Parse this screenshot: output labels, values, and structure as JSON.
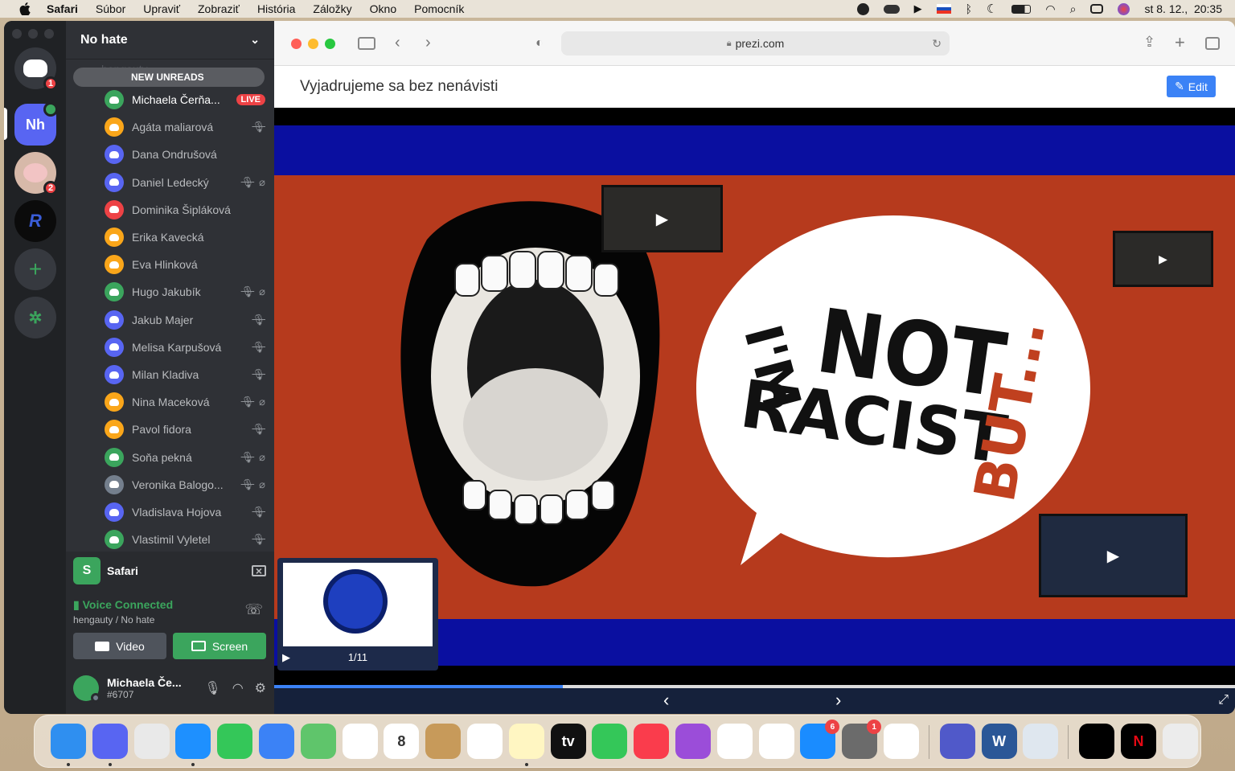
{
  "menubar": {
    "app": "Safari",
    "items": [
      "Súbor",
      "Upraviť",
      "Zobraziť",
      "História",
      "Záložky",
      "Okno",
      "Pomocník"
    ],
    "datetime": "st 8. 12.,  20:35"
  },
  "discord": {
    "servers": [
      {
        "name": "Discord home",
        "label": "",
        "badge": "1",
        "color": "#36393f"
      },
      {
        "name": "No hate server",
        "label": "Nh",
        "badge": "",
        "color": "#5865f2"
      },
      {
        "name": "pig server",
        "label": "",
        "badge": "2",
        "color": "#d7b9a9"
      },
      {
        "name": "RaveX003 server",
        "label": "R",
        "badge": "",
        "color": "#0b0b0b"
      }
    ],
    "channel_header": "No hate",
    "ghost_channel": "hengauty",
    "new_unreads": "NEW UNREADS",
    "members": [
      {
        "name": "Michaela Čerňa...",
        "color": "#3ba55d",
        "live": "LIVE",
        "deaf": false,
        "muted": false
      },
      {
        "name": "Agáta maliarová",
        "color": "#faa61a",
        "muted": true,
        "deaf": false
      },
      {
        "name": "Dana Ondrušová",
        "color": "#5865f2",
        "muted": false,
        "deaf": false
      },
      {
        "name": "Daniel Ledecký",
        "color": "#5865f2",
        "muted": true,
        "deaf": true
      },
      {
        "name": "Dominika Šipláková",
        "color": "#ed4245",
        "muted": false,
        "deaf": false
      },
      {
        "name": "Erika Kavecká",
        "color": "#faa61a",
        "muted": false,
        "deaf": false
      },
      {
        "name": "Eva Hlinková",
        "color": "#faa61a",
        "muted": false,
        "deaf": false
      },
      {
        "name": "Hugo Jakubík",
        "color": "#3ba55d",
        "muted": true,
        "deaf": true
      },
      {
        "name": "Jakub Majer",
        "color": "#5865f2",
        "muted": true,
        "deaf": false
      },
      {
        "name": "Melisa Karpušová",
        "color": "#5865f2",
        "muted": true,
        "deaf": false
      },
      {
        "name": "Milan Kladiva",
        "color": "#5865f2",
        "muted": true,
        "deaf": false
      },
      {
        "name": "Nina Maceková",
        "color": "#faa61a",
        "muted": true,
        "deaf": true
      },
      {
        "name": "Pavol fidora",
        "color": "#faa61a",
        "muted": true,
        "deaf": false
      },
      {
        "name": "Soňa pekná",
        "color": "#3ba55d",
        "muted": true,
        "deaf": true
      },
      {
        "name": "Veronika Balogo...",
        "color": "#747f8d",
        "muted": true,
        "deaf": true
      },
      {
        "name": "Vladislava Hojova",
        "color": "#5865f2",
        "muted": true,
        "deaf": false
      },
      {
        "name": "Vlastimil Vyletel",
        "color": "#3ba55d",
        "muted": true,
        "deaf": false
      }
    ],
    "share": {
      "app": "Safari"
    },
    "voice": {
      "status": "Voice Connected",
      "location": "hengauty / No hate"
    },
    "buttons": {
      "video": "Video",
      "screen": "Screen"
    },
    "user": {
      "name": "Michaela Če...",
      "tag": "#6707"
    }
  },
  "safari": {
    "url": "prezi.com",
    "page_title": "Vyjadrujeme sa bez nenávisti",
    "edit_label": "Edit",
    "slide_counter": "1/11",
    "progress": 0.3
  },
  "dock": {
    "apps": [
      {
        "name": "finder",
        "label": "",
        "color": "#2f8ff0",
        "badge": "",
        "running": true
      },
      {
        "name": "discord",
        "label": "",
        "color": "#5865f2",
        "badge": "",
        "running": true
      },
      {
        "name": "launchpad",
        "label": "",
        "color": "#e9e9e9",
        "badge": "",
        "running": false
      },
      {
        "name": "safari",
        "label": "",
        "color": "#1e90ff",
        "badge": "",
        "running": true
      },
      {
        "name": "messages",
        "label": "",
        "color": "#34c759",
        "badge": "",
        "running": false
      },
      {
        "name": "mail",
        "label": "",
        "color": "#3b82f6",
        "badge": "",
        "running": false
      },
      {
        "name": "maps",
        "label": "",
        "color": "#5fc56b",
        "badge": "",
        "running": false
      },
      {
        "name": "photos",
        "label": "",
        "color": "#ffffff",
        "badge": "",
        "running": false
      },
      {
        "name": "calendar",
        "label": "8",
        "color": "#ffffff",
        "badge": "",
        "running": false
      },
      {
        "name": "contacts",
        "label": "",
        "color": "#c79a5a",
        "badge": "",
        "running": false
      },
      {
        "name": "reminders",
        "label": "",
        "color": "#ffffff",
        "badge": "",
        "running": false
      },
      {
        "name": "notes",
        "label": "",
        "color": "#fff6c2",
        "badge": "",
        "running": true
      },
      {
        "name": "apple-tv",
        "label": "tv",
        "color": "#111111",
        "badge": "",
        "running": false
      },
      {
        "name": "facetime",
        "label": "",
        "color": "#34c759",
        "badge": "",
        "running": false
      },
      {
        "name": "music",
        "label": "",
        "color": "#fa3c4c",
        "badge": "",
        "running": false
      },
      {
        "name": "podcasts",
        "label": "",
        "color": "#9b4dd9",
        "badge": "",
        "running": false
      },
      {
        "name": "numbers",
        "label": "",
        "color": "#ffffff",
        "badge": "",
        "running": false
      },
      {
        "name": "pages",
        "label": "",
        "color": "#ffffff",
        "badge": "",
        "running": false
      },
      {
        "name": "app-store",
        "label": "",
        "color": "#1a8cff",
        "badge": "6",
        "running": false
      },
      {
        "name": "system-preferences",
        "label": "",
        "color": "#6b6b6b",
        "badge": "1",
        "running": false
      },
      {
        "name": "messenger",
        "label": "",
        "color": "#ffffff",
        "badge": "",
        "running": false
      },
      {
        "name": "teams",
        "label": "",
        "color": "#5059c9",
        "badge": "",
        "running": false
      },
      {
        "name": "word",
        "label": "W",
        "color": "#2b5797",
        "badge": "",
        "running": false
      },
      {
        "name": "preview",
        "label": "",
        "color": "#dfe7ef",
        "badge": "",
        "running": false
      },
      {
        "name": "spotify",
        "label": "",
        "color": "#000000",
        "badge": "",
        "running": false
      },
      {
        "name": "netflix",
        "label": "N",
        "color": "#000000",
        "badge": "",
        "running": false
      },
      {
        "name": "trash",
        "label": "",
        "color": "#ececec",
        "badge": "",
        "running": false
      }
    ]
  }
}
